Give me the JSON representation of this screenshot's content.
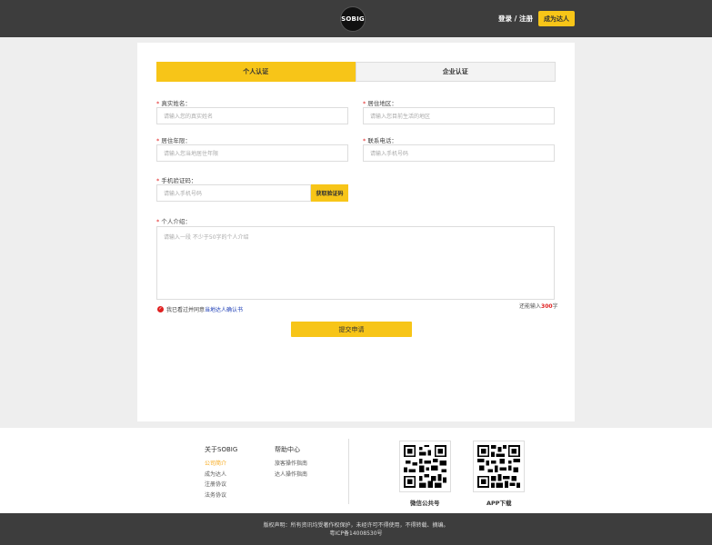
{
  "header": {
    "logo_text": "SOBIG",
    "login_register": "登录 / 注册",
    "become_talent": "成为达人"
  },
  "tabs": [
    {
      "label": "个人认证",
      "active": true
    },
    {
      "label": "企业认证",
      "active": false
    }
  ],
  "form": {
    "real_name": {
      "label": "真实姓名：",
      "placeholder": "请输入您的真实姓名"
    },
    "region": {
      "label": "居住地区：",
      "placeholder": "请输入您目前生活的地区"
    },
    "years": {
      "label": "居住年限：",
      "placeholder": "请输入您当地居住年限"
    },
    "phone": {
      "label": "联系电话：",
      "placeholder": "请输入手机号码"
    },
    "sms_code": {
      "label": "手机验证码：",
      "placeholder": "请输入手机号码",
      "button": "获取验证码"
    },
    "intro": {
      "label": "个人介绍：",
      "placeholder": "请输入一段 不少于50字的个人介绍"
    },
    "required_mark": "*",
    "counter_prefix": "还能输入",
    "counter_num": "300",
    "counter_suffix": "字",
    "agree_text": "我已看过并同意",
    "agree_link": "当地达人确认书",
    "submit": "提交申请"
  },
  "footer": {
    "about": {
      "title": "关于SOBIG",
      "items": [
        "公司简介",
        "成为达人",
        "注册协议",
        "法务协议"
      ]
    },
    "help": {
      "title": "帮助中心",
      "items": [
        "旅客操作指南",
        "达人操作指南"
      ]
    },
    "qr": [
      {
        "label": "微信公共号"
      },
      {
        "label": "APP下载"
      }
    ],
    "copyright_line1": "版权声明：所有资讯均受著作权保护，未经许可不得使用，不得转载、摘编。",
    "copyright_line2": "粤ICP备14008530号"
  },
  "colors": {
    "accent": "#f7c518",
    "header_bg": "#3d3d3d",
    "required": "#e02020"
  }
}
